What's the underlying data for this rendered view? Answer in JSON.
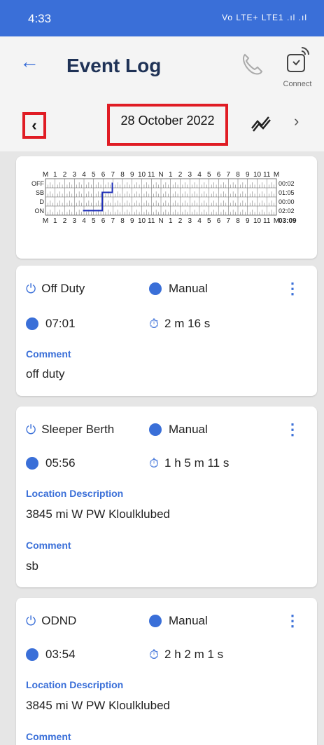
{
  "status_bar": {
    "time": "4:33",
    "indicators": "Vo LTE+ LTE1 .ıl .ıl"
  },
  "app_bar": {
    "title": "Event Log",
    "connect_label": "Connect"
  },
  "date_nav": {
    "date": "28 October 2022"
  },
  "chart": {
    "hour_labels": [
      "M",
      "1",
      "2",
      "3",
      "4",
      "5",
      "6",
      "7",
      "8",
      "9",
      "10",
      "11",
      "N",
      "1",
      "2",
      "3",
      "4",
      "5",
      "6",
      "7",
      "8",
      "9",
      "10",
      "11",
      "M"
    ],
    "rows": [
      "OFF",
      "SB",
      "D",
      "ON"
    ],
    "durations": [
      "00:02",
      "01:05",
      "00:00",
      "02:02"
    ],
    "total": "03:09"
  },
  "chart_data": {
    "type": "line",
    "title": "",
    "xlabel": "",
    "ylabel": "",
    "x_axis": "hour of day",
    "categories": [
      "OFF",
      "SB",
      "D",
      "ON"
    ],
    "segments": [
      {
        "status": "ON",
        "start_hour": 3.9,
        "end_hour": 5.9
      },
      {
        "status": "SB",
        "start_hour": 5.9,
        "end_hour": 6.95
      },
      {
        "status": "OFF",
        "start_hour": 6.95,
        "end_hour": 7.0
      }
    ],
    "xlim": [
      0,
      24
    ]
  },
  "events": [
    {
      "status": "Off Duty",
      "origin": "Manual",
      "time": "07:01",
      "duration": "2 m 16 s",
      "comment_label": "Comment",
      "comment": "off duty"
    },
    {
      "status": "Sleeper Berth",
      "origin": "Manual",
      "time": "05:56",
      "duration": "1 h 5 m 11 s",
      "location_label": "Location Description",
      "location": "3845 mi W PW Kloulklubed",
      "comment_label": "Comment",
      "comment": "sb"
    },
    {
      "status": "ODND",
      "origin": "Manual",
      "time": "03:54",
      "duration": "2 h 2 m 1 s",
      "location_label": "Location Description",
      "location": "3845 mi W PW Kloulklubed",
      "comment_label": "Comment"
    }
  ],
  "colors": {
    "accent": "#3a6fd8",
    "highlight": "#e01c24",
    "title": "#1f3256"
  }
}
